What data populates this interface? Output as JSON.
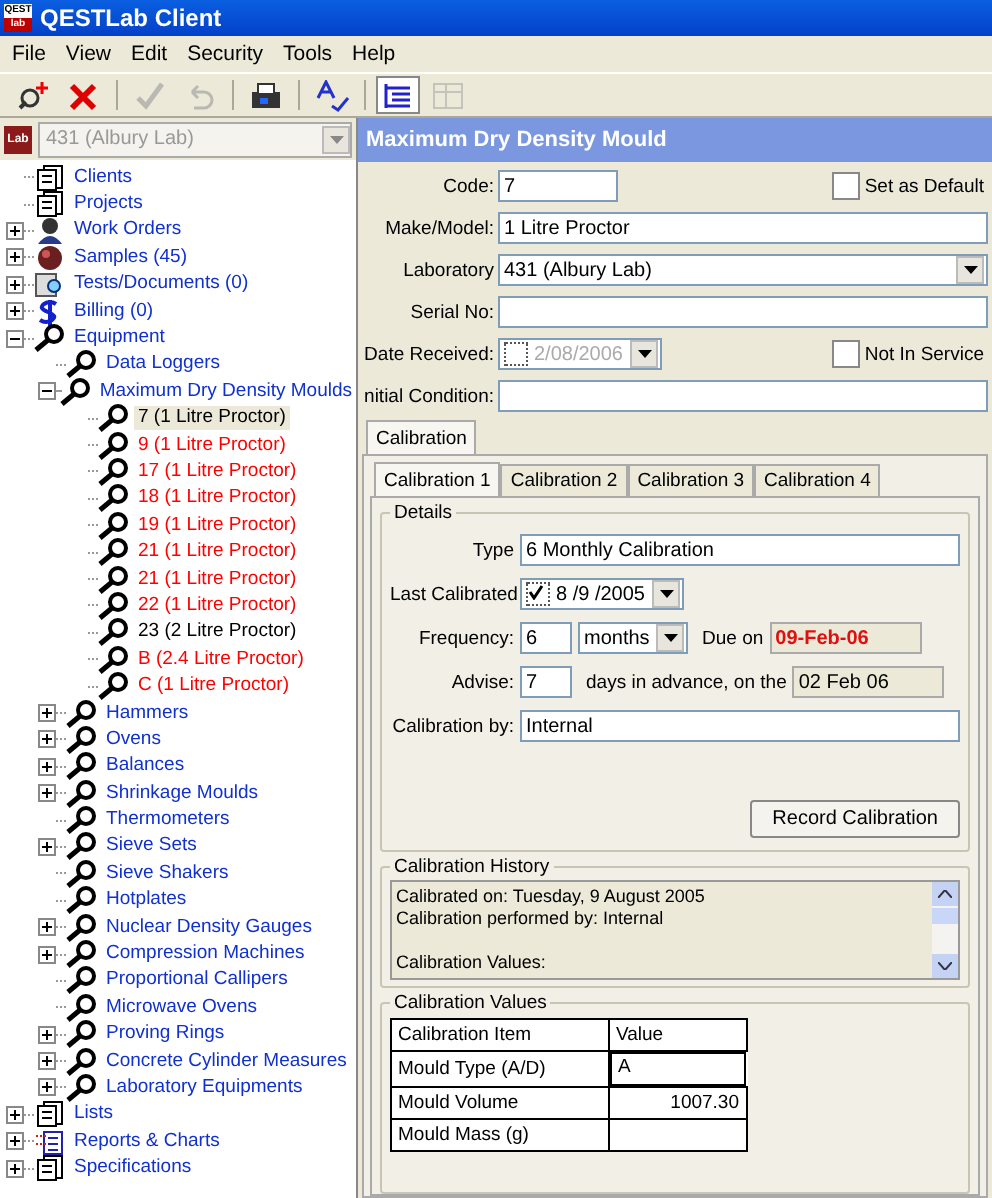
{
  "window": {
    "title": "QESTLab Client",
    "icon_top": "QEST",
    "icon_bottom": "lab"
  },
  "menu": [
    "File",
    "View",
    "Edit",
    "Security",
    "Tools",
    "Help"
  ],
  "toolbar": [
    {
      "kind": "new",
      "disabled": false,
      "selected": false
    },
    {
      "kind": "delete",
      "disabled": false,
      "selected": false
    },
    {
      "kind": "check",
      "disabled": true,
      "selected": false
    },
    {
      "kind": "undo",
      "disabled": true,
      "selected": false
    },
    {
      "kind": "print",
      "disabled": false,
      "selected": false
    },
    {
      "kind": "spell",
      "disabled": false,
      "selected": false
    },
    {
      "kind": "tree",
      "disabled": false,
      "selected": true
    },
    {
      "kind": "grid",
      "disabled": true,
      "selected": false
    }
  ],
  "lab_picker": {
    "logo": "Lab",
    "value": "431 (Albury Lab)",
    "disabled": true
  },
  "tree": [
    {
      "label": "Clients",
      "kind": "docs",
      "selected": false
    },
    {
      "label": "Projects",
      "kind": "docs",
      "selected": false
    },
    {
      "label": "Work Orders",
      "kind": "person",
      "expanded": false,
      "selected": false
    },
    {
      "label": "Samples (45)",
      "kind": "samples",
      "expanded": false,
      "selected": false
    },
    {
      "label": "Tests/Documents (0)",
      "kind": "tests",
      "expanded": false,
      "selected": false
    },
    {
      "label": "Billing (0)",
      "kind": "billing",
      "expanded": false,
      "selected": false
    },
    {
      "label": "Equipment",
      "kind": "equipment",
      "expanded": true,
      "selected": false,
      "children": [
        {
          "label": "Data Loggers",
          "kind": "equipment",
          "selected": false
        },
        {
          "label": "Maximum Dry Density Moulds",
          "kind": "equipment",
          "expanded": true,
          "selected": false,
          "children": [
            {
              "label": "7 (1 Litre Proctor)",
              "kind": "equipment",
              "color": "#000000",
              "selected": true
            },
            {
              "label": "9 (1 Litre Proctor)",
              "kind": "equipment",
              "color": "#ff0000",
              "selected": false
            },
            {
              "label": "17 (1 Litre Proctor)",
              "kind": "equipment",
              "color": "#ff0000",
              "selected": false
            },
            {
              "label": "18 (1 Litre Proctor)",
              "kind": "equipment",
              "color": "#ff0000",
              "selected": false
            },
            {
              "label": "19 (1 Litre Proctor)",
              "kind": "equipment",
              "color": "#ff0000",
              "selected": false
            },
            {
              "label": "21 (1 Litre Proctor)",
              "kind": "equipment",
              "color": "#ff0000",
              "selected": false
            },
            {
              "label": "21 (1 Litre Proctor)",
              "kind": "equipment",
              "color": "#ff0000",
              "selected": false
            },
            {
              "label": "22 (1 Litre Proctor)",
              "kind": "equipment",
              "color": "#ff0000",
              "selected": false
            },
            {
              "label": "23 (2 Litre Proctor)",
              "kind": "equipment",
              "color": "#000000",
              "selected": false
            },
            {
              "label": "B (2.4 Litre Proctor)",
              "kind": "equipment",
              "color": "#ff0000",
              "selected": false
            },
            {
              "label": "C (1 Litre Proctor)",
              "kind": "equipment",
              "color": "#ff0000",
              "selected": false
            }
          ]
        },
        {
          "label": "Hammers",
          "kind": "equipment",
          "expanded": false,
          "selected": false
        },
        {
          "label": "Ovens",
          "kind": "equipment",
          "expanded": false,
          "selected": false
        },
        {
          "label": "Balances",
          "kind": "equipment",
          "expanded": false,
          "selected": false
        },
        {
          "label": "Shrinkage Moulds",
          "kind": "equipment",
          "expanded": false,
          "selected": false
        },
        {
          "label": "Thermometers",
          "kind": "equipment",
          "selected": false
        },
        {
          "label": "Sieve Sets",
          "kind": "equipment",
          "expanded": false,
          "selected": false
        },
        {
          "label": "Sieve Shakers",
          "kind": "equipment",
          "selected": false
        },
        {
          "label": "Hotplates",
          "kind": "equipment",
          "selected": false
        },
        {
          "label": "Nuclear Density Gauges",
          "kind": "equipment",
          "expanded": false,
          "selected": false
        },
        {
          "label": "Compression Machines",
          "kind": "equipment",
          "expanded": false,
          "selected": false
        },
        {
          "label": "Proportional Callipers",
          "kind": "equipment",
          "selected": false
        },
        {
          "label": "Microwave Ovens",
          "kind": "equipment",
          "selected": false
        },
        {
          "label": "Proving Rings",
          "kind": "equipment",
          "expanded": false,
          "selected": false
        },
        {
          "label": "Concrete Cylinder Measures",
          "kind": "equipment",
          "expanded": false,
          "selected": false
        },
        {
          "label": "Laboratory Equipments",
          "kind": "equipment",
          "expanded": false,
          "selected": false
        }
      ]
    },
    {
      "label": "Lists",
      "kind": "docs",
      "expanded": false,
      "selected": false
    },
    {
      "label": "Reports & Charts",
      "kind": "reports",
      "expanded": false,
      "selected": false
    },
    {
      "label": "Specifications",
      "kind": "specs",
      "expanded": false,
      "selected": false
    }
  ],
  "header": "Maximum Dry Density Mould",
  "form": {
    "code": {
      "label": "Code:",
      "value": "7"
    },
    "set_default": {
      "label": "Set as Default",
      "checked": false
    },
    "make_model": {
      "label": "Make/Model:",
      "value": "1 Litre Proctor"
    },
    "laboratory": {
      "label": "Laboratory",
      "value": "431 (Albury Lab)"
    },
    "serial": {
      "label": "Serial No:"
    },
    "date_received": {
      "label": "Date Received:",
      "checked": false,
      "value": "2/08/2006"
    },
    "not_in_service": {
      "label": "Not In Service",
      "checked": false
    },
    "initial_condition": {
      "label": "nitial Condition:"
    }
  },
  "tabs": [
    {
      "label": "Calibration",
      "selected": true
    }
  ],
  "calibration_tabs": [
    {
      "label": "Calibration 1",
      "selected": true
    },
    {
      "label": "Calibration 2",
      "selected": false
    },
    {
      "label": "Calibration 3",
      "selected": false
    },
    {
      "label": "Calibration 4",
      "selected": false
    }
  ],
  "details": {
    "title": "Details",
    "type": {
      "label": "Type",
      "value": "6 Monthly Calibration"
    },
    "last_calibrated": {
      "label": "Last Calibrated",
      "checked": true,
      "value": "8 /9 /2005"
    },
    "frequency": {
      "label": "Frequency:",
      "value": "6",
      "unit": "months"
    },
    "due_on": {
      "label": "Due on",
      "value": "09-Feb-06"
    },
    "advise": {
      "label": "Advise:",
      "value": "7",
      "suffix": "days in advance, on the",
      "date": "02 Feb 06"
    },
    "calibration_by": {
      "label": "Calibration by:",
      "value": "Internal"
    },
    "button": "Record Calibration"
  },
  "history": {
    "title": "Calibration History",
    "text": "Calibrated on: Tuesday, 9 August 2005\nCalibration performed by: Internal\n\nCalibration Values:"
  },
  "values": {
    "title": "Calibration Values",
    "columns": [
      "Calibration Item",
      "Value"
    ],
    "rows": [
      {
        "item": "Mould Type (A/D)",
        "value": "A"
      },
      {
        "item": "Mould Volume",
        "value": "1007.30"
      },
      {
        "item": "Mould Mass (g)"
      }
    ]
  }
}
